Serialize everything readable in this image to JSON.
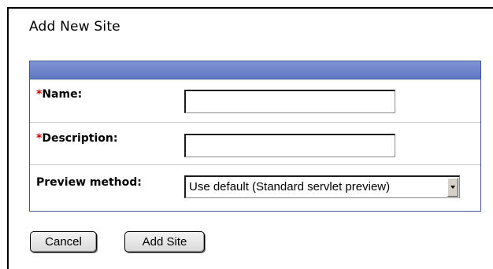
{
  "page": {
    "title": "Add New Site"
  },
  "form": {
    "required_marker": "*",
    "fields": {
      "name": {
        "label": "Name:",
        "value": "",
        "required": true
      },
      "description": {
        "label": "Description:",
        "value": "",
        "required": true
      },
      "preview_method": {
        "label": "Preview method:",
        "selected": "Use default (Standard servlet preview)"
      }
    }
  },
  "buttons": {
    "cancel": "Cancel",
    "add_site": "Add Site"
  },
  "colors": {
    "header_bar": "#5f77c4",
    "required_star": "#cc0000",
    "box_border": "#43599a"
  }
}
